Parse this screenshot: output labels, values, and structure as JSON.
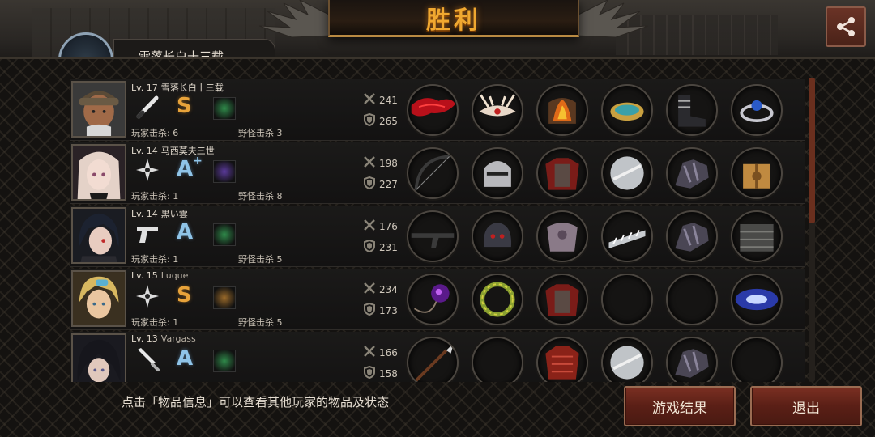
{
  "title": "胜利",
  "self": {
    "name": "雪落长白十三载"
  },
  "players": [
    {
      "level": "Lv. 17",
      "name": "雪落长白十三载",
      "latin": false,
      "weapon": "bat-icon",
      "grade": "S",
      "grade_plus": "",
      "skill_color": "#2f8a4a",
      "player_kills_label": "玩家击杀: 6",
      "monster_kills_label": "野怪击杀 3",
      "attack": "241",
      "defense": "265",
      "items": [
        "red-scarf-icon",
        "antler-helmet-icon",
        "flame-armor-icon",
        "bracelet-icon",
        "black-boots-icon",
        "sapphire-ring-icon"
      ]
    },
    {
      "level": "Lv. 14",
      "name": "马西莫夫三世",
      "latin": false,
      "weapon": "shuriken-icon",
      "grade": "A",
      "grade_plus": "+",
      "skill_color": "#5a3a9a",
      "player_kills_label": "玩家击杀: 1",
      "monster_kills_label": "野怪击杀 8",
      "attack": "198",
      "defense": "227",
      "items": [
        "bow-icon",
        "knight-helmet-icon",
        "crimson-armor-icon",
        "steel-shield-icon",
        "gauntlet-icon",
        "gift-box-icon"
      ]
    },
    {
      "level": "Lv. 14",
      "name": "黒い雲",
      "latin": false,
      "weapon": "pistol-icon",
      "grade": "A",
      "grade_plus": "",
      "skill_color": "#2f8a4a",
      "player_kills_label": "玩家击杀: 1",
      "monster_kills_label": "野怪击杀 5",
      "attack": "176",
      "defense": "231",
      "items": [
        "crossbow-icon",
        "steel-helmet-icon",
        "plate-armor-icon",
        "feather-bracer-icon",
        "gauntlet-icon",
        "chain-armor-icon"
      ]
    },
    {
      "level": "Lv. 15",
      "name": "Luque",
      "latin": true,
      "weapon": "shuriken-icon",
      "grade": "S",
      "grade_plus": "",
      "skill_color": "#9a6a2a",
      "player_kills_label": "玩家击杀: 1",
      "monster_kills_label": "野怪击杀 5",
      "attack": "234",
      "defense": "173",
      "items": [
        "amulet-icon",
        "laurel-wreath-icon",
        "crimson-armor-icon",
        "empty-slot",
        "empty-slot",
        "galaxy-orb-icon"
      ]
    },
    {
      "level": "Lv. 13",
      "name": "Vargass",
      "latin": true,
      "weapon": "knife-icon",
      "grade": "A",
      "grade_plus": "",
      "skill_color": "#2f8a4a",
      "player_kills_label": "",
      "monster_kills_label": "",
      "attack": "166",
      "defense": "158",
      "items": [
        "spear-icon",
        "empty-slot",
        "red-armor-icon",
        "steel-shield-icon",
        "gauntlet-icon",
        "empty-slot"
      ]
    }
  ],
  "hint_text": "点击「物品信息」可以查看其他玩家的物品及状态",
  "buttons": {
    "result": "游戏结果",
    "exit": "退出"
  },
  "colors": {
    "accent_gold": "#f0a830",
    "button_red": "#6a2418",
    "grade_s": "#e8a33a",
    "grade_a": "#8fc4e8"
  }
}
